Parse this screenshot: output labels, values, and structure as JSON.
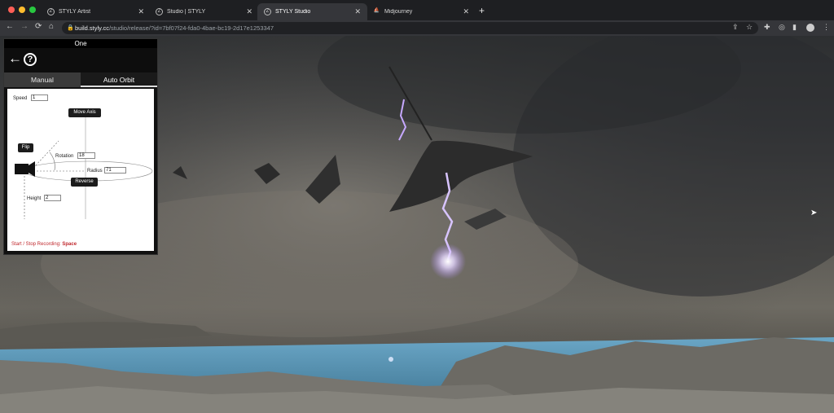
{
  "browser": {
    "tabs": [
      {
        "title": "STYLY Artist",
        "favicon": "styly-icon",
        "active": false
      },
      {
        "title": "Studio | STYLY",
        "favicon": "styly-icon",
        "active": false
      },
      {
        "title": "STYLY Studio",
        "favicon": "styly-icon",
        "active": true
      },
      {
        "title": "Midjourney",
        "favicon": "midjourney-icon",
        "active": false
      }
    ],
    "new_tab": "+",
    "url_domain": "build.styly.cc",
    "url_path": "/studio/release/?id=7bf07f24-fda0-4bae-bc19-2d17e1253347",
    "colors": {
      "close": "#ff5f57",
      "minimize": "#febc2e",
      "maximize": "#28c840"
    }
  },
  "panel": {
    "title": "One",
    "tabs": {
      "manual": "Manual",
      "auto_orbit": "Auto Orbit"
    },
    "speed_label": "Speed",
    "speed_value": "1",
    "move_axis": "Move Axis",
    "flip": "Flip",
    "rotation_label": "Rotation",
    "rotation_value": "18",
    "radius_label": "Radius",
    "radius_value": "71",
    "reverse": "Reverse",
    "height_label": "Height",
    "height_value": "2",
    "recording_prefix": "Start / Stop Recording: ",
    "recording_key": "Space"
  }
}
